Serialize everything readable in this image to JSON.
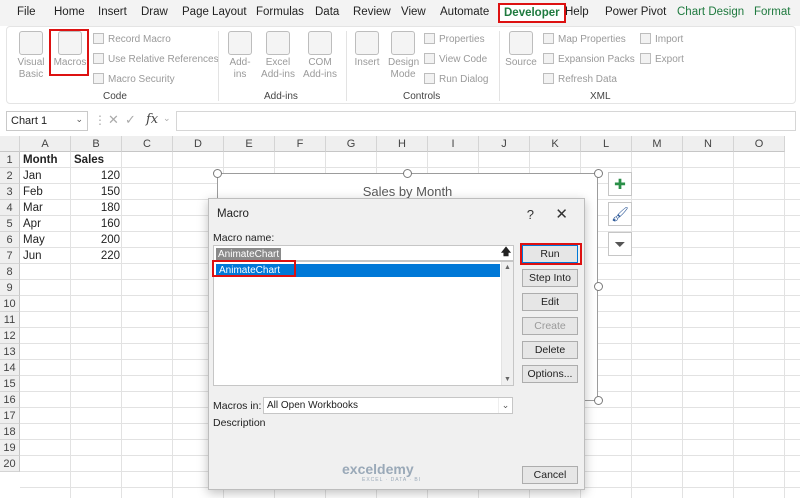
{
  "menu": {
    "tabs": [
      "File",
      "Home",
      "Insert",
      "Draw",
      "Page Layout",
      "Formulas",
      "Data",
      "Review",
      "View",
      "Automate",
      "Developer",
      "Help",
      "Power Pivot",
      "Chart Design",
      "Format"
    ]
  },
  "ribbon": {
    "code": {
      "visual_basic": "Visual Basic",
      "macros": "Macros",
      "record_macro": "Record Macro",
      "use_relative": "Use Relative References",
      "macro_security": "Macro Security",
      "group": "Code"
    },
    "addins": {
      "addins": "Add-ins",
      "excel_addins": "Excel Add-ins",
      "com_addins": "COM Add-ins",
      "group": "Add-ins"
    },
    "controls": {
      "insert": "Insert",
      "design_mode": "Design Mode",
      "properties": "Properties",
      "view_code": "View Code",
      "run_dialog": "Run Dialog",
      "group": "Controls"
    },
    "xml": {
      "source": "Source",
      "map_properties": "Map Properties",
      "expansion_packs": "Expansion Packs",
      "refresh_data": "Refresh Data",
      "import": "Import",
      "export": "Export",
      "group": "XML"
    }
  },
  "formula_bar": {
    "name_box": "Chart 1",
    "fx": "fx",
    "formula": ""
  },
  "sheet": {
    "columns": [
      "A",
      "B",
      "C",
      "D",
      "E",
      "F",
      "G",
      "H",
      "I",
      "J",
      "K",
      "L",
      "M",
      "N",
      "O"
    ],
    "rows": [
      "1",
      "2",
      "3",
      "4",
      "5",
      "6",
      "7",
      "8",
      "9",
      "10",
      "11",
      "12",
      "13",
      "14",
      "15",
      "16",
      "17",
      "18",
      "19",
      "20"
    ],
    "header": [
      "Month",
      "Sales"
    ],
    "data": [
      [
        "Jan",
        "120"
      ],
      [
        "Feb",
        "150"
      ],
      [
        "Mar",
        "180"
      ],
      [
        "Apr",
        "160"
      ],
      [
        "May",
        "200"
      ],
      [
        "Jun",
        "220"
      ]
    ]
  },
  "chart": {
    "title": "Sales by Month"
  },
  "dialog": {
    "title": "Macro",
    "help": "?",
    "close": "✕",
    "macro_name_label": "Macro name:",
    "macro_name_value": "AnimateChart",
    "macros": [
      "AnimateChart"
    ],
    "buttons": {
      "run": "Run",
      "step_into": "Step Into",
      "edit": "Edit",
      "create": "Create",
      "delete": "Delete",
      "options": "Options...",
      "cancel": "Cancel"
    },
    "macros_in_label": "Macros in:",
    "macros_in_value": "All Open Workbooks",
    "description_label": "Description"
  },
  "watermark": {
    "name": "exceldemy",
    "tag": "EXCEL · DATA · BI"
  }
}
